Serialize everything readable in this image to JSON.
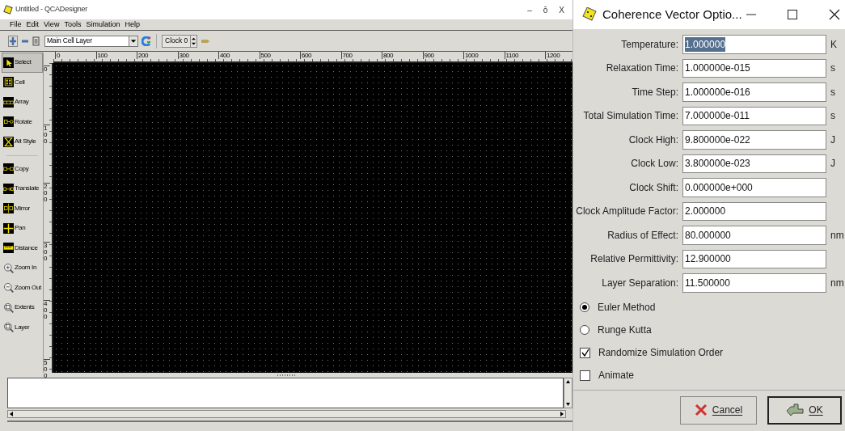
{
  "window": {
    "title": "Untitled - QCADesigner",
    "controls": [
      "–",
      "ō",
      "X"
    ]
  },
  "menu": [
    {
      "label": "File"
    },
    {
      "label": "Edit"
    },
    {
      "label": "View"
    },
    {
      "label": "Tools"
    },
    {
      "label": "Simulation"
    },
    {
      "label": "Help"
    }
  ],
  "toolbar": {
    "layer": "Main Cell Layer",
    "clock": "Clock 0"
  },
  "tool_groups": [
    [
      {
        "label": "Select",
        "kind": "select",
        "selected": true
      },
      {
        "label": "Cell",
        "kind": "cell",
        "selected": false
      },
      {
        "label": "Array",
        "kind": "array",
        "selected": false
      },
      {
        "label": "Rotate",
        "kind": "rotate",
        "selected": false
      },
      {
        "label": "Alt Style",
        "kind": "altstyle",
        "selected": false
      }
    ],
    [
      {
        "label": "Copy",
        "kind": "copy",
        "selected": false
      },
      {
        "label": "Translate",
        "kind": "translate",
        "selected": false
      },
      {
        "label": "Mirror",
        "kind": "mirror",
        "selected": false
      },
      {
        "label": "Pan",
        "kind": "pan",
        "selected": false
      },
      {
        "label": "Distance",
        "kind": "distance",
        "selected": false
      },
      {
        "label": "Zoom In",
        "kind": "zoomin",
        "selected": false
      },
      {
        "label": "Zoom Out",
        "kind": "zoomout",
        "selected": false
      },
      {
        "label": "Extents",
        "kind": "zoom",
        "selected": false
      },
      {
        "label": "Layer",
        "kind": "zoom",
        "selected": false
      }
    ]
  ],
  "ruler": {
    "horizontal": [
      "0",
      "100",
      "200",
      "300",
      "400",
      "500",
      "600",
      "700",
      "800",
      "900",
      "1000",
      "1100",
      "1200"
    ],
    "vertical": [
      "0",
      "100",
      "200",
      "300",
      "400",
      "500"
    ]
  },
  "dialog": {
    "title": "Coherence Vector Optio...",
    "fields": [
      {
        "label": "Temperature:",
        "value": "1.000000",
        "unit": "K",
        "selected": true
      },
      {
        "label": "Relaxation Time:",
        "value": "1.000000e-015",
        "unit": "s",
        "selected": false
      },
      {
        "label": "Time Step:",
        "value": "1.000000e-016",
        "unit": "s",
        "selected": false
      },
      {
        "label": "Total Simulation Time:",
        "value": "7.000000e-011",
        "unit": "s",
        "selected": false
      },
      {
        "label": "Clock High:",
        "value": "9.800000e-022",
        "unit": "J",
        "selected": false
      },
      {
        "label": "Clock Low:",
        "value": "3.800000e-023",
        "unit": "J",
        "selected": false
      },
      {
        "label": "Clock Shift:",
        "value": "0.000000e+000",
        "selected": false
      },
      {
        "label": "Clock Amplitude Factor:",
        "value": "2.000000",
        "selected": false
      },
      {
        "label": "Radius of Effect:",
        "value": "80.000000",
        "unit": "nm",
        "selected": false
      },
      {
        "label": "Relative Permittivity:",
        "value": "12.900000",
        "selected": false
      },
      {
        "label": "Layer Separation:",
        "value": "11.500000",
        "unit": "nm",
        "selected": false
      }
    ],
    "methods": [
      {
        "label": "Euler Method",
        "selected": true
      },
      {
        "label": "Runge Kutta",
        "selected": false
      }
    ],
    "options": [
      {
        "label": "Randomize Simulation Order",
        "checked": true
      },
      {
        "label": "Animate",
        "checked": false
      }
    ],
    "buttons": [
      {
        "label": "Cancel",
        "kind": "cancel"
      },
      {
        "label": "OK",
        "kind": "ok"
      }
    ]
  }
}
